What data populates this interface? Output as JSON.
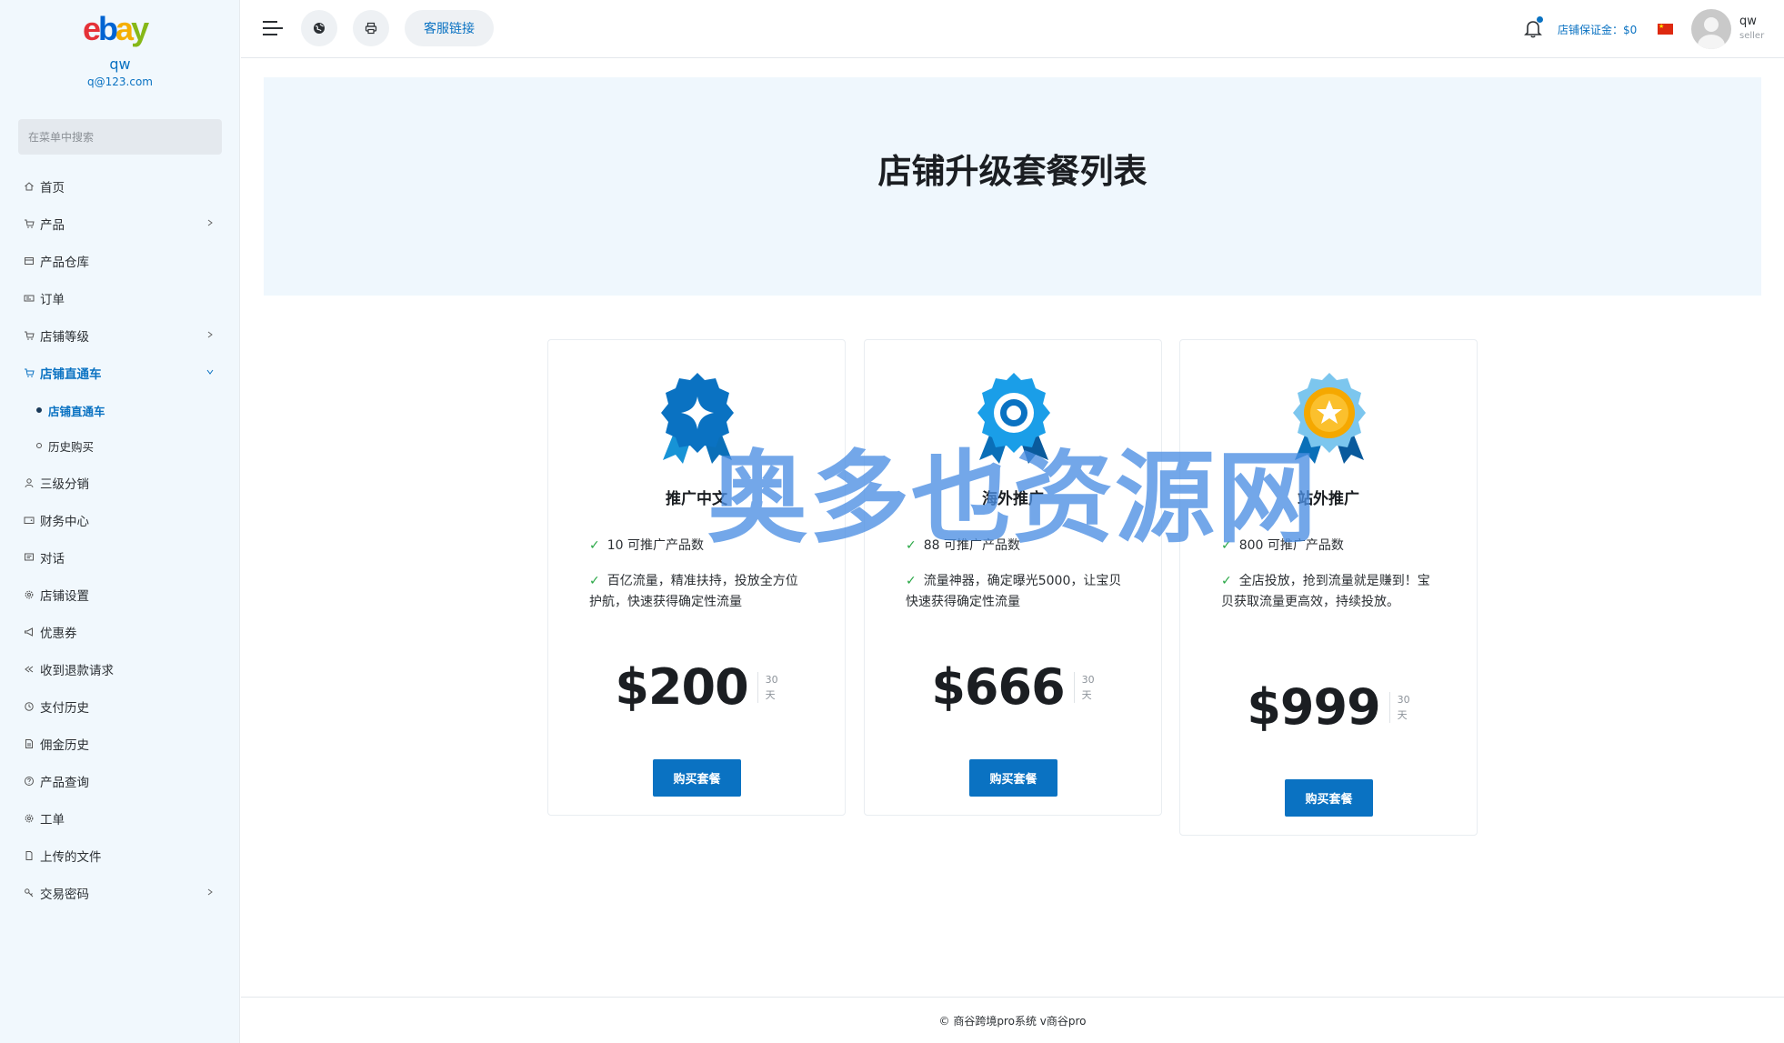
{
  "sidebar": {
    "logo": {
      "e": "e",
      "b": "b",
      "a": "a",
      "y": "y"
    },
    "user_name": "qw",
    "user_email": "q@123.com",
    "search_placeholder": "在菜单中搜索",
    "items": [
      {
        "label": "首页",
        "icon": "home-icon"
      },
      {
        "label": "产品",
        "icon": "cart-icon",
        "has_children": true
      },
      {
        "label": "产品仓库",
        "icon": "warehouse-icon"
      },
      {
        "label": "订单",
        "icon": "order-icon"
      },
      {
        "label": "店铺等级",
        "icon": "cart-icon",
        "has_children": true
      },
      {
        "label": "店铺直通车",
        "icon": "cart-icon",
        "has_children": true,
        "expanded": true,
        "active": true
      },
      {
        "label": "三级分销",
        "icon": "user-icon"
      },
      {
        "label": "财务中心",
        "icon": "wallet-icon"
      },
      {
        "label": "对话",
        "icon": "chat-icon"
      },
      {
        "label": "店铺设置",
        "icon": "gear-icon"
      },
      {
        "label": "优惠券",
        "icon": "megaphone-icon"
      },
      {
        "label": "收到退款请求",
        "icon": "refund-icon"
      },
      {
        "label": "支付历史",
        "icon": "history-icon"
      },
      {
        "label": "佣金历史",
        "icon": "document-icon"
      },
      {
        "label": "产品查询",
        "icon": "question-icon"
      },
      {
        "label": "工单",
        "icon": "gear-icon"
      },
      {
        "label": "上传的文件",
        "icon": "file-icon"
      },
      {
        "label": "交易密码",
        "icon": "key-icon",
        "has_children": true
      }
    ],
    "sub_items": [
      {
        "label": "店铺直通车",
        "active": true
      },
      {
        "label": "历史购买",
        "active": false
      }
    ]
  },
  "header": {
    "support_link": "客服链接",
    "deposit": "店铺保证金：$0",
    "user_name": "qw",
    "user_role": "seller",
    "icons": [
      "menu-icon",
      "globe-icon",
      "printer-icon",
      "bell-icon",
      "china-flag-icon",
      "avatar"
    ]
  },
  "main": {
    "title": "店铺升级套餐列表",
    "packages": [
      {
        "name": "推广中文",
        "feature_count": "10 可推广产品数",
        "description": "百亿流量，精准扶持，投放全方位护航，快速获得确定性流量",
        "price": "$200",
        "period_num": "30",
        "period_unit": "天",
        "buy_label": "购买套餐",
        "badge_icon": "blue-rosette-diamond-icon"
      },
      {
        "name": "海外推广",
        "feature_count": "88 可推广产品数",
        "description": "流量神器，确定曝光5000，让宝贝快速获得确定性流量",
        "price": "$666",
        "period_num": "30",
        "period_unit": "天",
        "buy_label": "购买套餐",
        "badge_icon": "blue-rosette-ring-icon"
      },
      {
        "name": "站外推广",
        "feature_count": "800 可推广产品数",
        "description": "全店投放，抢到流量就是赚到！宝贝获取流量更高效，持续投放。",
        "price": "$999",
        "period_num": "30",
        "period_unit": "天",
        "buy_label": "购买套餐",
        "badge_icon": "gold-star-medal-icon"
      }
    ]
  },
  "watermark": "奥多也资源网",
  "footer": "© 商谷跨境pro系统 v商谷pro",
  "colors": {
    "accent": "#0a72c2",
    "sidebar_bg": "#f1f8fd",
    "banner_bg": "#eff7fd",
    "check": "#28a745"
  }
}
